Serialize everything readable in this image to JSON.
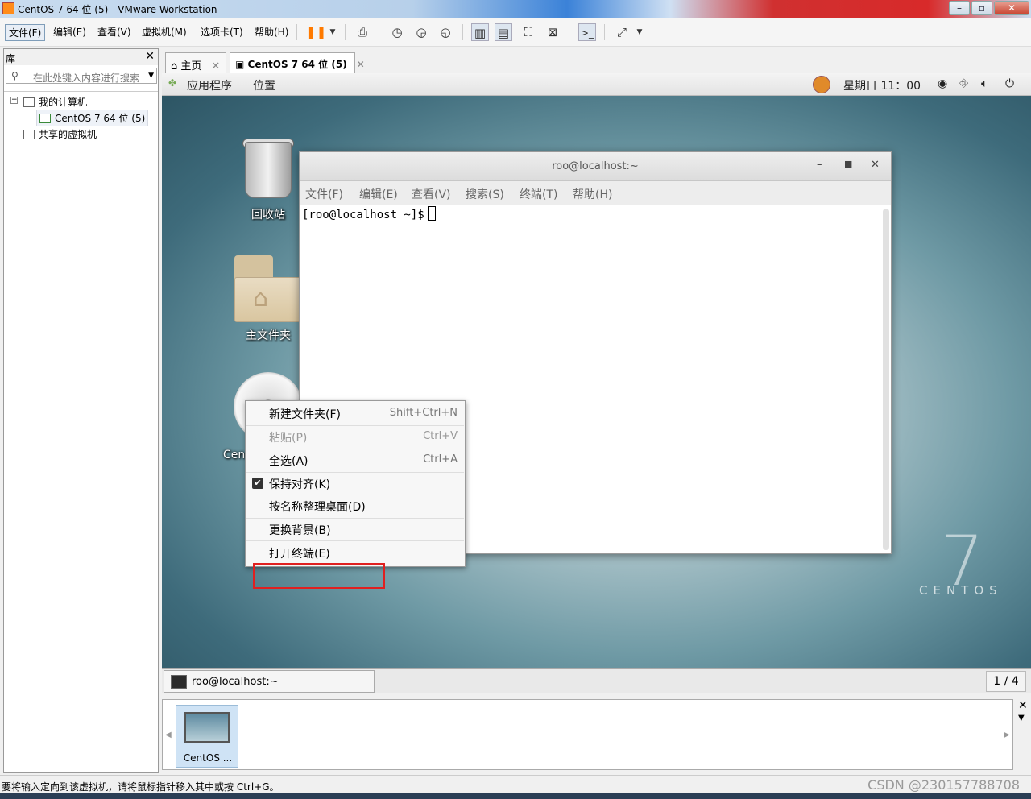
{
  "window": {
    "title": "CentOS 7 64 位 (5) - VMware Workstation"
  },
  "menubar": {
    "items": [
      "文件(F)",
      "编辑(E)",
      "查看(V)",
      "虚拟机(M)",
      "选项卡(T)",
      "帮助(H)"
    ]
  },
  "library": {
    "title": "库",
    "search_placeholder": "在此处键入内容进行搜索",
    "tree": {
      "my_computer": "我的计算机",
      "vm": "CentOS 7 64 位 (5)",
      "shared": "共享的虚拟机"
    }
  },
  "tabs": [
    {
      "label": "主页"
    },
    {
      "label": "CentOS 7 64 位 (5)"
    }
  ],
  "guest": {
    "topbar": {
      "applications": "应用程序",
      "places": "位置",
      "clock": "星期日 11：00"
    },
    "desktop_icons": {
      "trash": "回收站",
      "home": "主文件夹",
      "disc": "Cen"
    },
    "terminal": {
      "title": "roo@localhost:~",
      "menu": [
        "文件(F)",
        "编辑(E)",
        "查看(V)",
        "搜索(S)",
        "终端(T)",
        "帮助(H)"
      ],
      "prompt": "[roo@localhost ~]$"
    },
    "context_menu": [
      {
        "label": "新建文件夹(F)",
        "shortcut": "Shift+Ctrl+N"
      },
      {
        "label": "粘贴(P)",
        "shortcut": "Ctrl+V"
      },
      {
        "label": "全选(A)",
        "shortcut": "Ctrl+A"
      },
      {
        "label": "保持对齐(K)",
        "shortcut": ""
      },
      {
        "label": "按名称整理桌面(D)",
        "shortcut": ""
      },
      {
        "label": "更换背景(B)",
        "shortcut": ""
      },
      {
        "label": "打开终端(E)",
        "shortcut": ""
      }
    ],
    "branding": {
      "number": "7",
      "name": "CENTOS"
    },
    "bottom": {
      "task": "roo@localhost:~",
      "workspace": "1 / 4"
    }
  },
  "thumbnail": {
    "label": "CentOS ..."
  },
  "statusbar": {
    "text": "要将输入定向到该虚拟机，请将鼠标指针移入其中或按 Ctrl+G。",
    "watermark": "CSDN @230157788708"
  },
  "colors": {
    "highlight": "#e02020",
    "pause": "#ff7a00"
  }
}
